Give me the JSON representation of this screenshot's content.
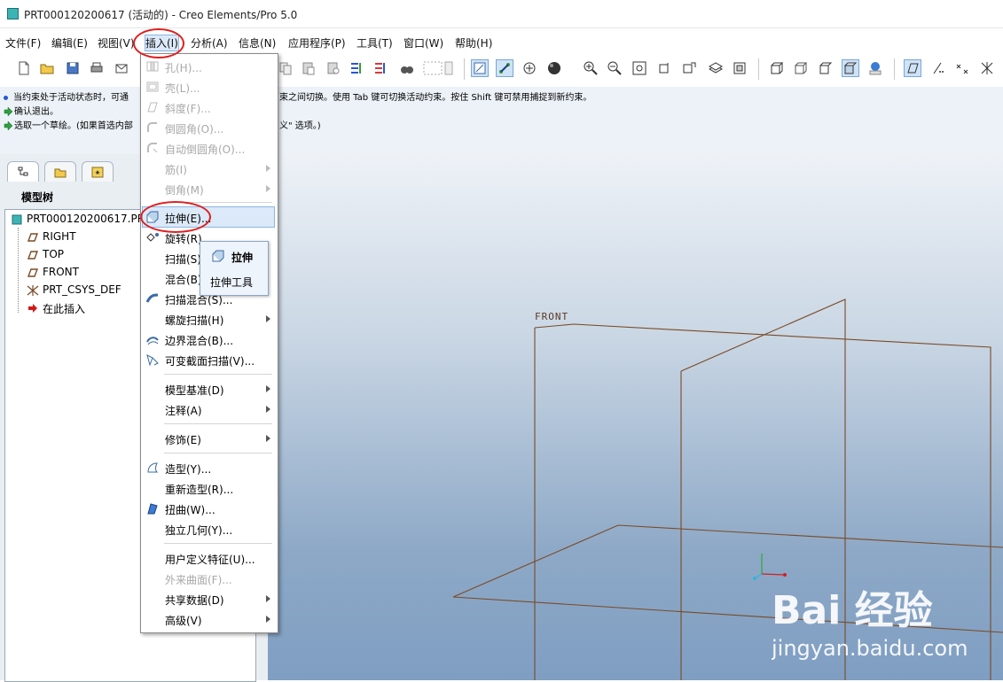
{
  "window": {
    "title": "PRT000120200617 (活动的) - Creo Elements/Pro 5.0"
  },
  "menubar": [
    {
      "label": "文件(F)"
    },
    {
      "label": "编辑(E)"
    },
    {
      "label": "视图(V)"
    },
    {
      "label": "插入(I)"
    },
    {
      "label": "分析(A)"
    },
    {
      "label": "信息(N)"
    },
    {
      "label": "应用程序(P)"
    },
    {
      "label": "工具(T)"
    },
    {
      "label": "窗口(W)"
    },
    {
      "label": "帮助(H)"
    }
  ],
  "messages": [
    {
      "text": "当约束处于活动状态时，可通",
      "tail": "束之间切换。使用 Tab 键可切换活动约束。按住 Shift 键可禁用捕捉到新约束。"
    },
    {
      "text": "确认退出。"
    },
    {
      "text": "选取一个草绘。(如果首选内部",
      "tail": "义\" 选项。)"
    }
  ],
  "model_tree": {
    "title": "模型树",
    "items": [
      {
        "label": "PRT000120200617.PRT"
      },
      {
        "label": "RIGHT"
      },
      {
        "label": "TOP"
      },
      {
        "label": "FRONT"
      },
      {
        "label": "PRT_CSYS_DEF"
      },
      {
        "label": "在此插入"
      }
    ]
  },
  "viewport": {
    "datum_label": "FRONT"
  },
  "insert_menu": {
    "items": [
      {
        "label": "孔(H)...",
        "enabled": false,
        "icon": "hole-icon"
      },
      {
        "label": "壳(L)...",
        "enabled": false,
        "icon": "shell-icon"
      },
      {
        "label": "斜度(F)...",
        "enabled": false,
        "icon": "draft-icon"
      },
      {
        "label": "倒圆角(O)...",
        "enabled": false,
        "icon": "round-icon"
      },
      {
        "label": "自动倒圆角(O)...",
        "enabled": false,
        "icon": "auto-round-icon"
      },
      {
        "label": "筋(I)",
        "enabled": false,
        "submenu": true
      },
      {
        "label": "倒角(M)",
        "enabled": false,
        "submenu": true
      },
      {
        "label": "拉伸(E)...",
        "enabled": true,
        "highlighted": true,
        "icon": "extrude-icon"
      },
      {
        "label": "旋转(R)",
        "enabled": true,
        "icon": "revolve-icon"
      },
      {
        "label": "扫描(S)",
        "enabled": true
      },
      {
        "label": "混合(B)",
        "enabled": true
      },
      {
        "label": "扫描混合(S)...",
        "enabled": true,
        "icon": "swept-blend-icon"
      },
      {
        "label": "螺旋扫描(H)",
        "enabled": true,
        "submenu": true
      },
      {
        "label": "边界混合(B)...",
        "enabled": true,
        "icon": "boundary-blend-icon"
      },
      {
        "label": "可变截面扫描(V)...",
        "enabled": true,
        "icon": "var-section-sweep-icon"
      },
      {
        "label": "模型基准(D)",
        "enabled": true,
        "submenu": true
      },
      {
        "label": "注释(A)",
        "enabled": true,
        "submenu": true
      },
      {
        "label": "修饰(E)",
        "enabled": true,
        "submenu": true
      },
      {
        "label": "造型(Y)...",
        "enabled": true,
        "icon": "style-icon"
      },
      {
        "label": "重新造型(R)...",
        "enabled": true
      },
      {
        "label": "扭曲(W)...",
        "enabled": true,
        "icon": "warp-icon"
      },
      {
        "label": "独立几何(Y)...",
        "enabled": true
      },
      {
        "label": "用户定义特征(U)...",
        "enabled": true
      },
      {
        "label": "外来曲面(F)...",
        "enabled": false
      },
      {
        "label": "共享数据(D)",
        "enabled": true,
        "submenu": true
      },
      {
        "label": "高级(V)",
        "enabled": true,
        "submenu": true
      }
    ]
  },
  "tooltip": {
    "title": "拉伸",
    "subtitle": "拉伸工具"
  },
  "colors": {
    "annotation": "#e01e1e",
    "datum_lines": "#7a4a25",
    "menu_highlight": "#dbe9f8"
  },
  "watermark": {
    "brand": "Bai 经验",
    "url": "jingyan.baidu.com"
  }
}
